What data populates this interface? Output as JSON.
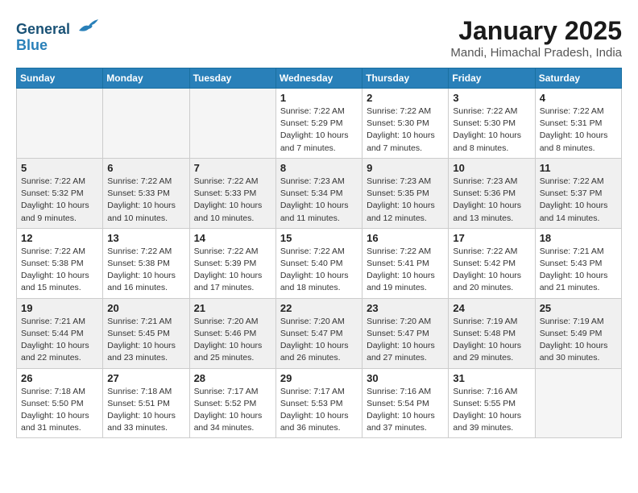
{
  "header": {
    "logo_line1": "General",
    "logo_line2": "Blue",
    "title": "January 2025",
    "subtitle": "Mandi, Himachal Pradesh, India"
  },
  "weekdays": [
    "Sunday",
    "Monday",
    "Tuesday",
    "Wednesday",
    "Thursday",
    "Friday",
    "Saturday"
  ],
  "weeks": [
    [
      {
        "day": "",
        "info": ""
      },
      {
        "day": "",
        "info": ""
      },
      {
        "day": "",
        "info": ""
      },
      {
        "day": "1",
        "info": "Sunrise: 7:22 AM\nSunset: 5:29 PM\nDaylight: 10 hours\nand 7 minutes."
      },
      {
        "day": "2",
        "info": "Sunrise: 7:22 AM\nSunset: 5:30 PM\nDaylight: 10 hours\nand 7 minutes."
      },
      {
        "day": "3",
        "info": "Sunrise: 7:22 AM\nSunset: 5:30 PM\nDaylight: 10 hours\nand 8 minutes."
      },
      {
        "day": "4",
        "info": "Sunrise: 7:22 AM\nSunset: 5:31 PM\nDaylight: 10 hours\nand 8 minutes."
      }
    ],
    [
      {
        "day": "5",
        "info": "Sunrise: 7:22 AM\nSunset: 5:32 PM\nDaylight: 10 hours\nand 9 minutes."
      },
      {
        "day": "6",
        "info": "Sunrise: 7:22 AM\nSunset: 5:33 PM\nDaylight: 10 hours\nand 10 minutes."
      },
      {
        "day": "7",
        "info": "Sunrise: 7:22 AM\nSunset: 5:33 PM\nDaylight: 10 hours\nand 10 minutes."
      },
      {
        "day": "8",
        "info": "Sunrise: 7:23 AM\nSunset: 5:34 PM\nDaylight: 10 hours\nand 11 minutes."
      },
      {
        "day": "9",
        "info": "Sunrise: 7:23 AM\nSunset: 5:35 PM\nDaylight: 10 hours\nand 12 minutes."
      },
      {
        "day": "10",
        "info": "Sunrise: 7:23 AM\nSunset: 5:36 PM\nDaylight: 10 hours\nand 13 minutes."
      },
      {
        "day": "11",
        "info": "Sunrise: 7:22 AM\nSunset: 5:37 PM\nDaylight: 10 hours\nand 14 minutes."
      }
    ],
    [
      {
        "day": "12",
        "info": "Sunrise: 7:22 AM\nSunset: 5:38 PM\nDaylight: 10 hours\nand 15 minutes."
      },
      {
        "day": "13",
        "info": "Sunrise: 7:22 AM\nSunset: 5:38 PM\nDaylight: 10 hours\nand 16 minutes."
      },
      {
        "day": "14",
        "info": "Sunrise: 7:22 AM\nSunset: 5:39 PM\nDaylight: 10 hours\nand 17 minutes."
      },
      {
        "day": "15",
        "info": "Sunrise: 7:22 AM\nSunset: 5:40 PM\nDaylight: 10 hours\nand 18 minutes."
      },
      {
        "day": "16",
        "info": "Sunrise: 7:22 AM\nSunset: 5:41 PM\nDaylight: 10 hours\nand 19 minutes."
      },
      {
        "day": "17",
        "info": "Sunrise: 7:22 AM\nSunset: 5:42 PM\nDaylight: 10 hours\nand 20 minutes."
      },
      {
        "day": "18",
        "info": "Sunrise: 7:21 AM\nSunset: 5:43 PM\nDaylight: 10 hours\nand 21 minutes."
      }
    ],
    [
      {
        "day": "19",
        "info": "Sunrise: 7:21 AM\nSunset: 5:44 PM\nDaylight: 10 hours\nand 22 minutes."
      },
      {
        "day": "20",
        "info": "Sunrise: 7:21 AM\nSunset: 5:45 PM\nDaylight: 10 hours\nand 23 minutes."
      },
      {
        "day": "21",
        "info": "Sunrise: 7:20 AM\nSunset: 5:46 PM\nDaylight: 10 hours\nand 25 minutes."
      },
      {
        "day": "22",
        "info": "Sunrise: 7:20 AM\nSunset: 5:47 PM\nDaylight: 10 hours\nand 26 minutes."
      },
      {
        "day": "23",
        "info": "Sunrise: 7:20 AM\nSunset: 5:47 PM\nDaylight: 10 hours\nand 27 minutes."
      },
      {
        "day": "24",
        "info": "Sunrise: 7:19 AM\nSunset: 5:48 PM\nDaylight: 10 hours\nand 29 minutes."
      },
      {
        "day": "25",
        "info": "Sunrise: 7:19 AM\nSunset: 5:49 PM\nDaylight: 10 hours\nand 30 minutes."
      }
    ],
    [
      {
        "day": "26",
        "info": "Sunrise: 7:18 AM\nSunset: 5:50 PM\nDaylight: 10 hours\nand 31 minutes."
      },
      {
        "day": "27",
        "info": "Sunrise: 7:18 AM\nSunset: 5:51 PM\nDaylight: 10 hours\nand 33 minutes."
      },
      {
        "day": "28",
        "info": "Sunrise: 7:17 AM\nSunset: 5:52 PM\nDaylight: 10 hours\nand 34 minutes."
      },
      {
        "day": "29",
        "info": "Sunrise: 7:17 AM\nSunset: 5:53 PM\nDaylight: 10 hours\nand 36 minutes."
      },
      {
        "day": "30",
        "info": "Sunrise: 7:16 AM\nSunset: 5:54 PM\nDaylight: 10 hours\nand 37 minutes."
      },
      {
        "day": "31",
        "info": "Sunrise: 7:16 AM\nSunset: 5:55 PM\nDaylight: 10 hours\nand 39 minutes."
      },
      {
        "day": "",
        "info": ""
      }
    ]
  ]
}
